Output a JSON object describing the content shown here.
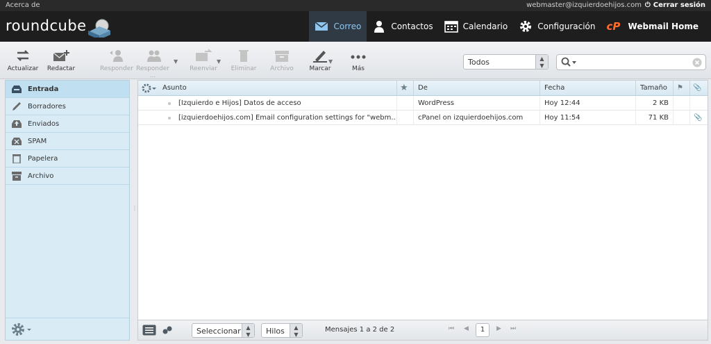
{
  "topbar": {
    "about": "Acerca de",
    "username": "webmaster@izquierdoehijos.com",
    "logout": "Cerrar sesión"
  },
  "header": {
    "logo": "roundcube"
  },
  "nav": {
    "mail": "Correo",
    "contacts": "Contactos",
    "calendar": "Calendario",
    "settings": "Configuración",
    "webmail_home": "Webmail Home"
  },
  "toolbar": {
    "refresh": "Actualizar",
    "compose": "Redactar",
    "reply": "Responder",
    "reply_all": "Responder ...",
    "forward": "Reenviar",
    "delete": "Eliminar",
    "archive": "Archivo",
    "mark": "Marcar",
    "more": "Más"
  },
  "filter": {
    "selected": "Todos"
  },
  "search": {
    "placeholder": ""
  },
  "folders": [
    {
      "label": "Entrada",
      "icon": "inbox-icon",
      "selected": true
    },
    {
      "label": "Borradores",
      "icon": "pencil-icon",
      "selected": false
    },
    {
      "label": "Enviados",
      "icon": "sent-icon",
      "selected": false
    },
    {
      "label": "SPAM",
      "icon": "spam-icon",
      "selected": false
    },
    {
      "label": "Papelera",
      "icon": "trash-icon",
      "selected": false
    },
    {
      "label": "Archivo",
      "icon": "archive-icon",
      "selected": false
    }
  ],
  "list": {
    "columns": {
      "subject": "Asunto",
      "from": "De",
      "date": "Fecha",
      "size": "Tamaño"
    },
    "messages": [
      {
        "subject": "[Izquierdo e Hijos] Datos de acceso",
        "from": "WordPress",
        "date": "Hoy 12:44",
        "size": "2 KB",
        "attachment": false
      },
      {
        "subject": "[izquierdoehijos.com] Email configuration settings for \"webm...",
        "from": "cPanel on izquierdoehijos.com",
        "date": "Hoy 11:54",
        "size": "71 KB",
        "attachment": true
      }
    ]
  },
  "footer": {
    "select": "Seleccionar",
    "threads": "Hilos",
    "count": "Mensajes 1 a 2 de 2",
    "page": "1"
  },
  "colors": {
    "active_tab_text": "#8fc6ef",
    "sidebar_bg": "#d9ecf6",
    "header_bg": "#1e1e1e"
  }
}
